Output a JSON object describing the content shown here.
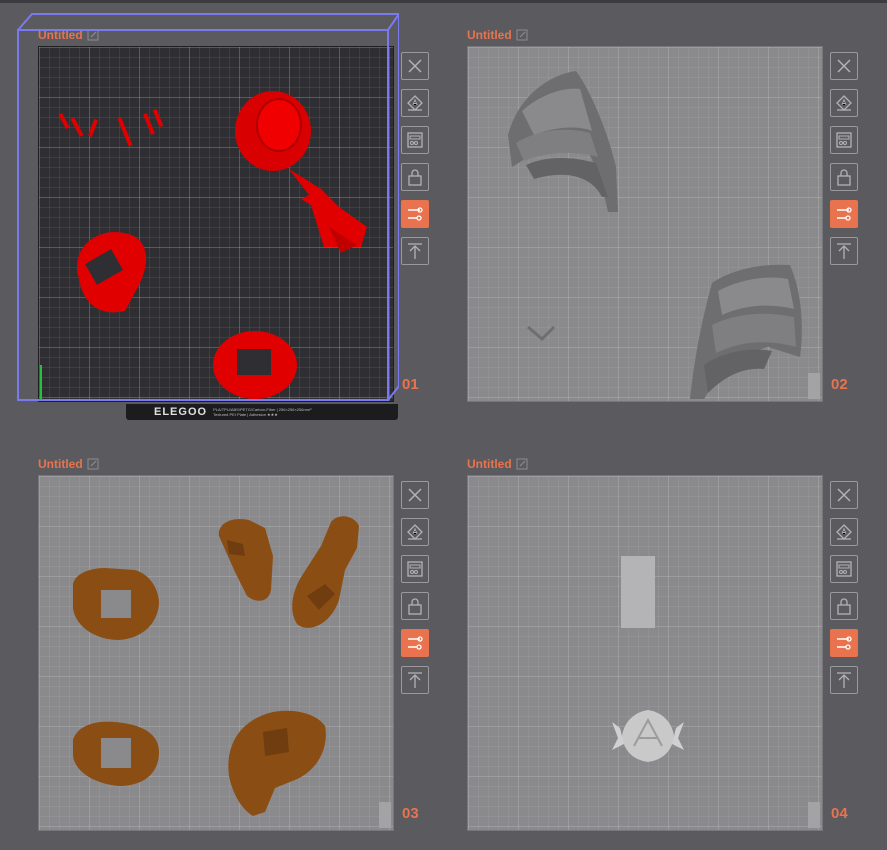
{
  "colors": {
    "accent": "#e8734e",
    "background": "#5b5b5f",
    "plate_light": "#8a8a8d",
    "plate_dark": "#2f2f33",
    "model_red": "#e00000",
    "model_gray": "#767679",
    "model_brown": "#8a4e14",
    "model_light": "#c9c9c9",
    "selection": "#7b79f0"
  },
  "toolbar_icons": [
    "close-icon",
    "auto-orient-icon",
    "arrange-icon",
    "lock-icon",
    "plate-settings-icon",
    "move-to-top-icon"
  ],
  "plates": [
    {
      "title": "Untitled",
      "number": "01",
      "brand": "ELEGOO",
      "plate_spec": "PLA/TPU/ABS/PETG/Carbon-Fiber | 256×256×256mm³",
      "plate_type": "Textured PEI Plate | Adhesion ★★★",
      "selected": true
    },
    {
      "title": "Untitled",
      "number": "02",
      "selected": false
    },
    {
      "title": "Untitled",
      "number": "03",
      "selected": false
    },
    {
      "title": "Untitled",
      "number": "04",
      "selected": false
    }
  ]
}
